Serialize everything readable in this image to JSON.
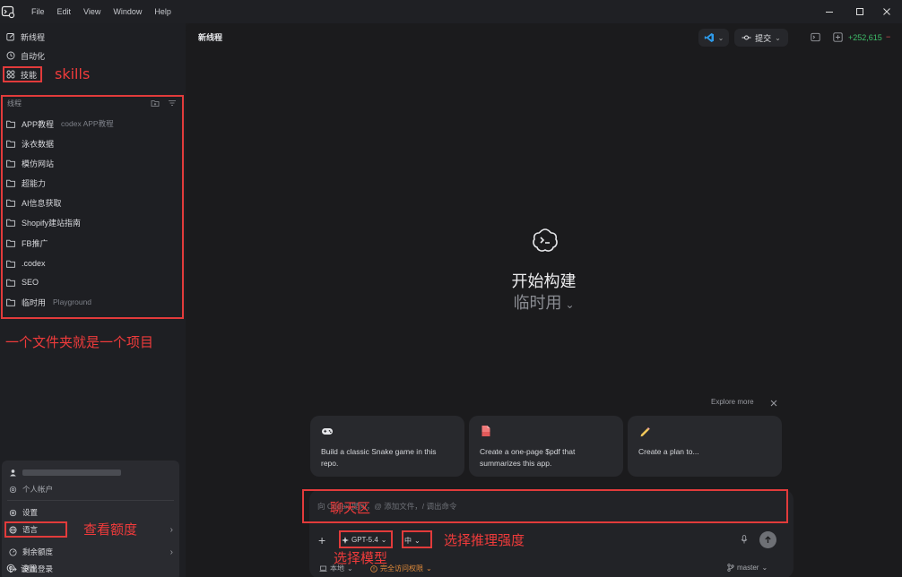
{
  "menu": [
    "File",
    "Edit",
    "View",
    "Window",
    "Help"
  ],
  "sidebar": {
    "new_thread": "新线程",
    "automation": "自动化",
    "skills": "技能",
    "threads_header": "线程",
    "threads": [
      {
        "name": "APP教程",
        "sub": "codex APP教程"
      },
      {
        "name": "泳衣数据",
        "sub": ""
      },
      {
        "name": "模仿网站",
        "sub": ""
      },
      {
        "name": "超能力",
        "sub": ""
      },
      {
        "name": "AI信息获取",
        "sub": ""
      },
      {
        "name": "Shopify建站指南",
        "sub": ""
      },
      {
        "name": "FB推广",
        "sub": ""
      },
      {
        "name": ".codex",
        "sub": ""
      },
      {
        "name": "SEO",
        "sub": ""
      },
      {
        "name": "临时用",
        "sub": "Playground"
      }
    ],
    "settings": "设置"
  },
  "popup": {
    "account": "个人帐户",
    "settings": "设置",
    "language": "语言",
    "remaining_quota": "剩余额度",
    "logout": "退出登录"
  },
  "annotations": {
    "skills": "skills",
    "folder_project": "一个文件夹就是一个项目",
    "view_quota": "查看额度",
    "chat_area": "聊天区",
    "select_model": "选择模型",
    "select_reasoning": "选择推理强度"
  },
  "main": {
    "title": "新线程",
    "commit": "提交",
    "diff_count": "+252,615",
    "diff_extra": "−",
    "hero_title": "开始构建",
    "hero_project": "临时用",
    "explore_more": "Explore more",
    "cards": [
      "Build a classic Snake game in this repo.",
      "Create a one-page $pdf that summarizes this app.",
      "Create a plan to..."
    ],
    "input_placeholder": "向 Codex 提问，@ 添加文件，/ 调出命令",
    "model": "GPT-5.4",
    "reasoning": "中",
    "local": "本地",
    "access": "完全访问权限",
    "branch": "master"
  },
  "colors": {
    "annotation": "#e23b3b",
    "diff_added": "#3fbf6a"
  }
}
